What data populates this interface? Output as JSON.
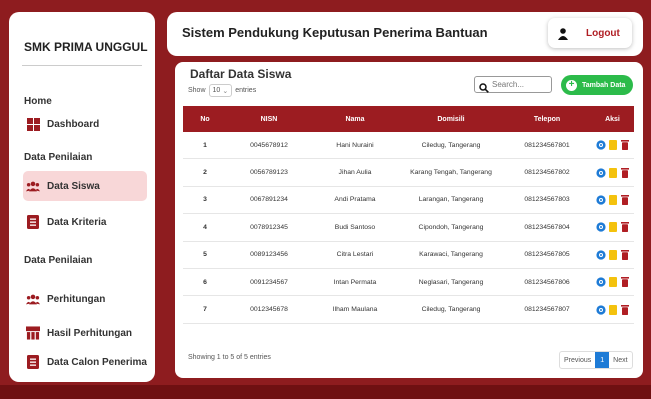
{
  "sidebar": {
    "brand": "SMK PRIMA UNGGUL",
    "home_heading": "Home",
    "dashboard": "Dashboard",
    "penilaian_heading_1": "Data Penilaian",
    "data_siswa": "Data Siswa",
    "data_kriteria": "Data Kriteria",
    "penilaian_heading_2": "Data Penilaian",
    "perhitungan": "Perhitungan",
    "hasil_perhitungan": "Hasil Perhitungan",
    "calon_penerima": "Data Calon Penerima"
  },
  "header": {
    "title": "Sistem Pendukung Keputusan Penerima Bantuan",
    "logout": "Logout"
  },
  "main": {
    "title": "Daftar Data Siswa",
    "show_label": "Show",
    "show_value": "10",
    "entries_label": "entries",
    "search_placeholder": "Search...",
    "add_button": "Tambah Data",
    "columns": [
      "No",
      "NISN",
      "Nama",
      "Domisili",
      "Telepon",
      "Aksi"
    ],
    "rows": [
      [
        "1",
        "0045678912",
        "Hani Nuraini",
        "Ciledug, Tangerang",
        "081234567801"
      ],
      [
        "2",
        "0056789123",
        "Jihan Aulia",
        "Karang Tengah, Tangerang",
        "081234567802"
      ],
      [
        "3",
        "0067891234",
        "Andi Pratama",
        "Larangan, Tangerang",
        "081234567803"
      ],
      [
        "4",
        "0078912345",
        "Budi Santoso",
        "Cipondoh, Tangerang",
        "081234567804"
      ],
      [
        "5",
        "0089123456",
        "Citra Lestari",
        "Karawaci, Tangerang",
        "081234567805"
      ],
      [
        "6",
        "0091234567",
        "Intan Permata",
        "Neglasari, Tangerang",
        "081234567806"
      ],
      [
        "7",
        "0012345678",
        "Ilham Maulana",
        "Ciledug, Tangerang",
        "081234567807"
      ]
    ],
    "footer_info": "Showing 1 to 5 of 5 entries",
    "pager_prev": "Previous",
    "pager_page": "1",
    "pager_next": "Next"
  },
  "colors": {
    "brand_red": "#9c1c21",
    "active_bg": "#f8d7d8",
    "add_green": "#2cbb4a",
    "view_blue": "#1e7bd6",
    "edit_yellow": "#f4c20d",
    "delete_red": "#b01e24"
  }
}
